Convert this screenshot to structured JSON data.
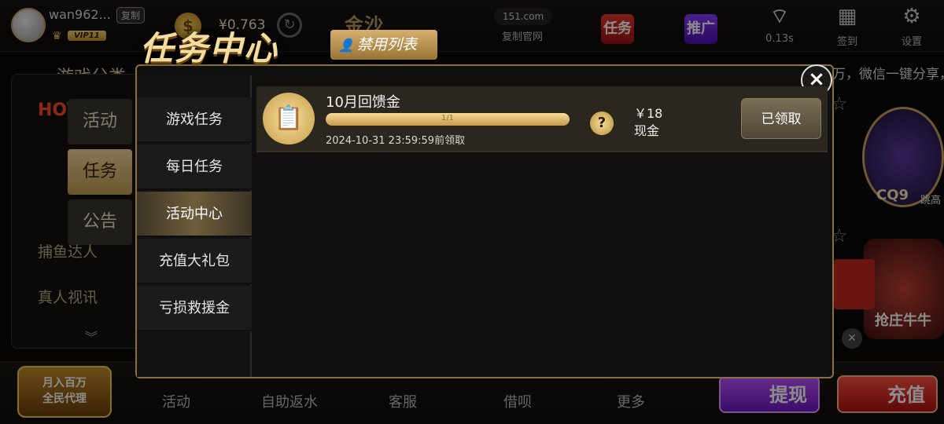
{
  "user": {
    "name": "wan962...",
    "copy_label": "复制",
    "vip": "VIP11"
  },
  "balance": "¥0.763",
  "brand": {
    "logo_text": "金沙",
    "domain": "151.com",
    "official_site_label": "复制官网"
  },
  "topnav": [
    {
      "label": "任务",
      "icon": "task-icon"
    },
    {
      "label": "推广",
      "icon": "promo-icon"
    },
    {
      "label": "0.13s",
      "icon": "wifi-signal-icon"
    },
    {
      "label": "签到",
      "icon": "calendar-checkin-icon"
    },
    {
      "label": "设置",
      "icon": "gear-icon"
    }
  ],
  "background": {
    "categories_title": "游戏分类",
    "side_tabs": [
      "活动",
      "任务",
      "公告"
    ],
    "left_items": [
      "捕鱼达人",
      "真人视讯"
    ],
    "marquee": "万，微信一键分享，",
    "cq9_label": "CQ9",
    "cq9_sub": "跳高",
    "bull_label": "抢庄牛牛"
  },
  "bottom": {
    "agent_promo": [
      "月入百万",
      "全民代理"
    ],
    "nav": [
      "活动",
      "自助返水",
      "客服",
      "借呗",
      "更多"
    ],
    "withdraw": "提现",
    "recharge": "充值"
  },
  "modal": {
    "title": "任务中心",
    "banned_list": "禁用列表",
    "tabs": [
      "游戏任务",
      "每日任务",
      "活动中心",
      "充值大礼包",
      "亏损救援金"
    ],
    "active_tab": "活动中心",
    "tasks": [
      {
        "name": "10月回馈金",
        "progress_text": "1/1",
        "progress": 1.0,
        "deadline": "2024-10-31 23:59:59前领取",
        "reward_amount": "￥18",
        "reward_type": "现金",
        "claim_label": "已领取"
      }
    ]
  }
}
